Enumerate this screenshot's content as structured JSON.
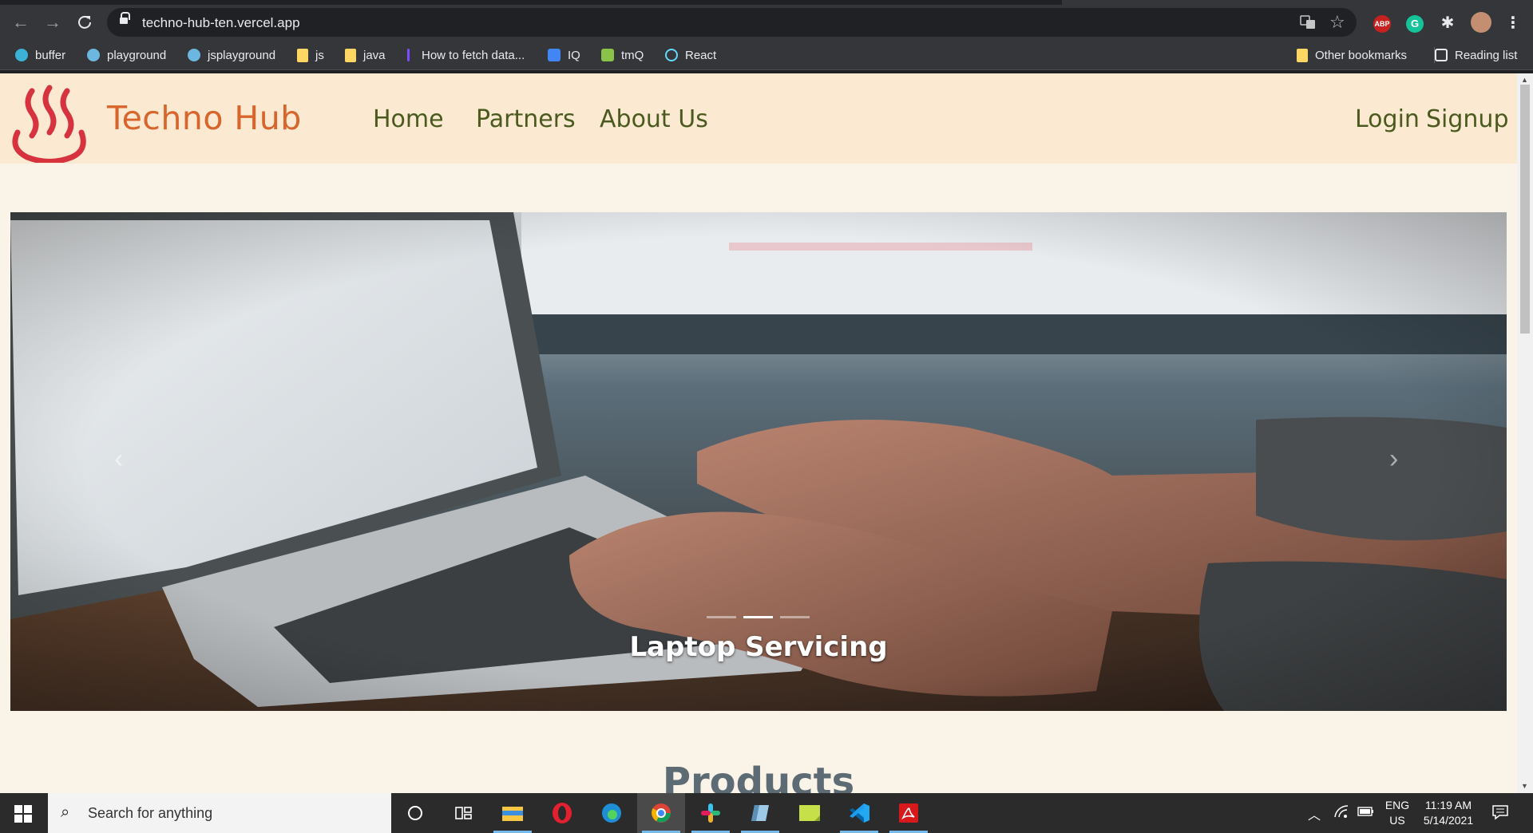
{
  "browser": {
    "url": "techno-hub-ten.vercel.app",
    "bookmarks": [
      {
        "label": "buffer"
      },
      {
        "label": "playground"
      },
      {
        "label": "jsplayground"
      },
      {
        "label": "js"
      },
      {
        "label": "java"
      },
      {
        "label": "How to fetch data..."
      },
      {
        "label": "IQ"
      },
      {
        "label": "tmQ"
      },
      {
        "label": "React"
      }
    ],
    "other_bookmarks": "Other bookmarks",
    "reading_list": "Reading list",
    "extensions": {
      "abp": "ABP",
      "grammarly": "G"
    }
  },
  "site": {
    "brand": "Techno Hub",
    "nav": {
      "home": "Home",
      "partners": "Partners",
      "about": "About Us"
    },
    "auth": {
      "login": "Login",
      "signup": "Signup"
    },
    "carousel": {
      "caption": "Laptop Servicing",
      "prev_icon": "chevron-left-icon",
      "next_icon": "chevron-right-icon",
      "slide_count": 3,
      "active_slide": 2
    },
    "products_title": "Products",
    "colors": {
      "header_bg": "#fbe9d2",
      "page_bg": "#faf3e7",
      "brand": "#d8652b",
      "nav": "#4a5a1e",
      "logo": "#d6333f"
    }
  },
  "taskbar": {
    "search_placeholder": "Search for anything",
    "lang_top": "ENG",
    "lang_bottom": "US",
    "time": "11:19 AM",
    "date": "5/14/2021"
  }
}
